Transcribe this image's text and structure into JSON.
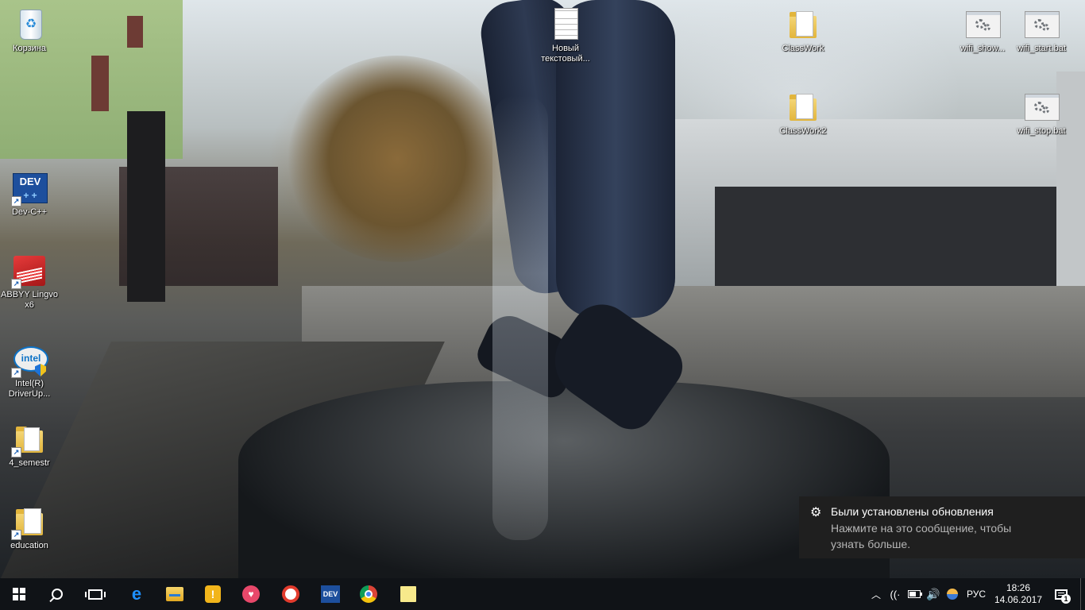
{
  "desktop": {
    "icons": [
      {
        "id": "recycle",
        "label": "Корзина",
        "icon": "recycle-bin-icon"
      },
      {
        "id": "devcpp",
        "label": "Dev-C++",
        "icon": "dev-cpp-icon",
        "icon_text": "DEV"
      },
      {
        "id": "abbyy",
        "label": "ABBYY Lingvo x6",
        "icon": "abbyy-lingvo-icon"
      },
      {
        "id": "intel",
        "label": "Intel(R) DriverUp...",
        "icon": "intel-driver-icon",
        "icon_text": "intel"
      },
      {
        "id": "semestr",
        "label": "4_semestr",
        "icon": "folder-icon"
      },
      {
        "id": "education",
        "label": "education",
        "icon": "folder-icon"
      },
      {
        "id": "newtxt",
        "label": "Новый текстовый...",
        "icon": "text-document-icon"
      },
      {
        "id": "classwork",
        "label": "ClassWork",
        "icon": "folder-icon"
      },
      {
        "id": "classwork2",
        "label": "ClassWork2",
        "icon": "folder-icon"
      },
      {
        "id": "wifishow",
        "label": "wifi_show...",
        "icon": "batch-file-icon"
      },
      {
        "id": "wifistart",
        "label": "wifi_start.bat",
        "icon": "batch-file-icon"
      },
      {
        "id": "wifistop",
        "label": "wifi_stop.bat",
        "icon": "batch-file-icon"
      }
    ]
  },
  "toast": {
    "title": "Были установлены обновления",
    "body": "Нажмите на это сообщение, чтобы узнать больше.",
    "icon": "gear-icon"
  },
  "taskbar": {
    "apps": [
      {
        "name": "start",
        "icon": "windows-start-icon"
      },
      {
        "name": "search",
        "icon": "search-icon"
      },
      {
        "name": "task-view",
        "icon": "task-view-icon"
      },
      {
        "name": "edge",
        "icon": "edge-icon",
        "glyph": "e"
      },
      {
        "name": "file-explorer",
        "icon": "file-explorer-icon"
      },
      {
        "name": "tips",
        "icon": "lightbulb-icon",
        "glyph": "💡"
      },
      {
        "name": "app-heart",
        "icon": "heart-app-icon",
        "glyph": "♥"
      },
      {
        "name": "tomato",
        "icon": "tomato-app-icon"
      },
      {
        "name": "dev-cpp",
        "icon": "dev-cpp-icon",
        "glyph": "DEV"
      },
      {
        "name": "chrome",
        "icon": "chrome-icon"
      },
      {
        "name": "sticky-notes",
        "icon": "sticky-notes-icon"
      }
    ],
    "tray": {
      "chevron": "︿",
      "wifi": "((·",
      "volume": "🔊",
      "language": "РУС",
      "time": "18:26",
      "date": "14.06.2017",
      "notification_count": "1"
    }
  },
  "colors": {
    "taskbar": "#101317",
    "toast": "#1f1f1f",
    "accent": "#7cb1e3"
  }
}
